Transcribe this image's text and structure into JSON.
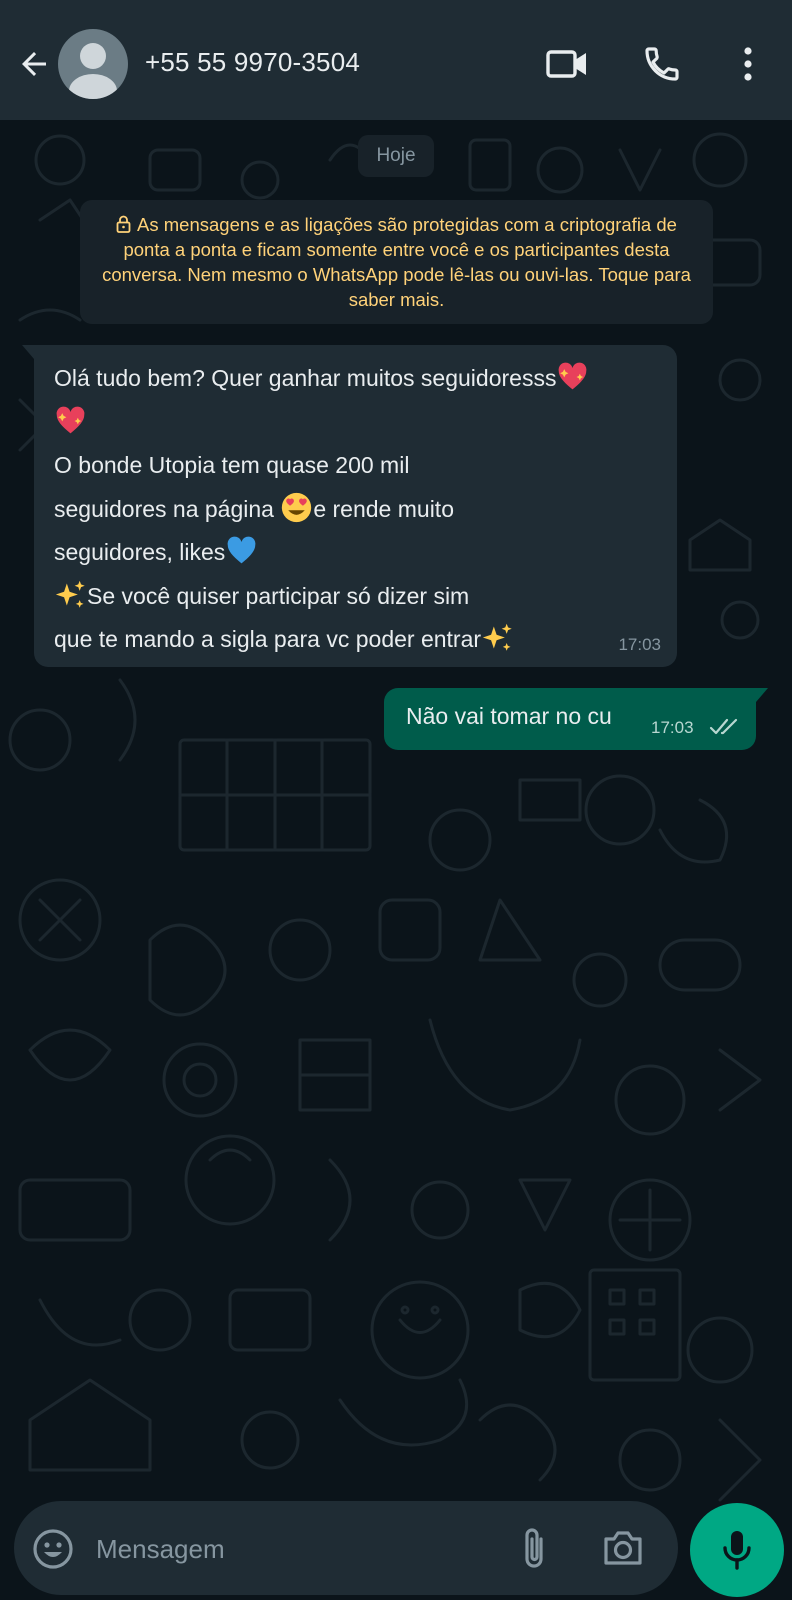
{
  "header": {
    "contact_name": "+55 55 9970-3504",
    "icons": [
      "back-arrow-icon",
      "avatar-placeholder",
      "video-call-icon",
      "phone-call-icon",
      "more-options-icon"
    ]
  },
  "chat": {
    "date_chip": "Hoje",
    "encryption_notice": "As mensagens e as ligações são protegidas com a criptografia de ponta a ponta e ficam somente entre você e os participantes desta conversa. Nem mesmo o WhatsApp pode lê-las ou ouvi-las. Toque para saber mais.",
    "messages": [
      {
        "direction": "incoming",
        "parts": {
          "p1": "Olá tudo bem? Quer ganhar muitos seguidoresss",
          "p2": "O bonde Utopia tem quase 200 mil",
          "p3": "seguidores na página ",
          "p4": "e rende muito",
          "p5": "seguidores, likes",
          "p6": "Se você quiser participar só dizer sim",
          "p7": "que te mando a sigla para vc poder entrar"
        },
        "emojis": [
          "heart-with-sparkles",
          "heart-with-sparkles",
          "heart-eyes",
          "blue-heart",
          "sparkles",
          "sparkles"
        ],
        "time": "17:03"
      },
      {
        "direction": "outgoing",
        "text": "Não vai tomar no cu",
        "time": "17:03",
        "status": "delivered-double-check"
      }
    ]
  },
  "input": {
    "placeholder": "Mensagem",
    "icons": [
      "emoji-icon",
      "attach-icon",
      "camera-icon",
      "mic-icon"
    ]
  },
  "colors": {
    "header_bg": "#1f2c34",
    "chat_bg": "#0b141a",
    "incoming_bubble": "#1f2c34",
    "outgoing_bubble": "#005c4b",
    "notice_text": "#ffd279",
    "accent": "#00a884"
  }
}
